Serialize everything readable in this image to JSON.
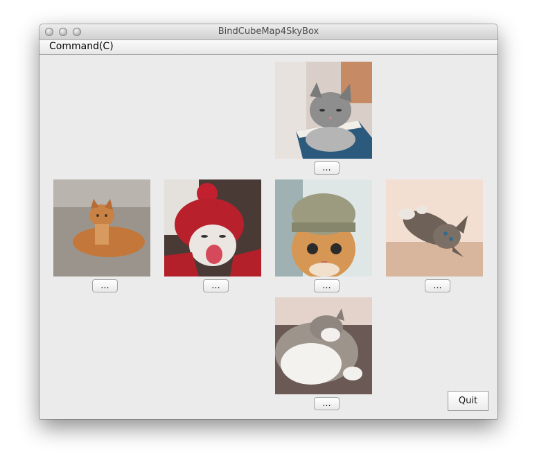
{
  "window": {
    "title": "BindCubeMap4SkyBox"
  },
  "menubar": {
    "items": [
      {
        "label": "Command(C)"
      }
    ]
  },
  "faces": [
    {
      "id": "top",
      "image": "gray-tabby-kitten-on-book",
      "button_label": "..."
    },
    {
      "id": "left",
      "image": "orange-cat-on-gravel",
      "button_label": "..."
    },
    {
      "id": "front",
      "image": "cat-in-red-knit-hood-yawning",
      "button_label": "..."
    },
    {
      "id": "right",
      "image": "orange-kitten-in-knit-hat",
      "button_label": "..."
    },
    {
      "id": "back",
      "image": "tabby-kitten-lying-on-floor",
      "button_label": "..."
    },
    {
      "id": "bottom",
      "image": "white-gray-cat-sleeping",
      "button_label": "..."
    }
  ],
  "quit_button": {
    "label": "Quit"
  }
}
